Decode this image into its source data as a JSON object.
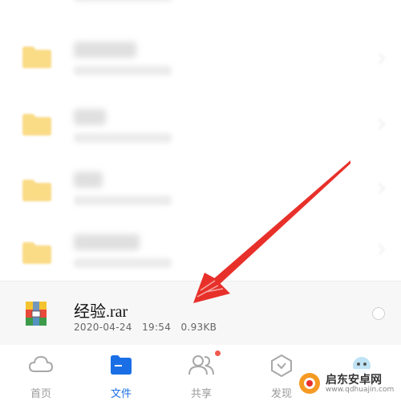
{
  "file_item": {
    "name": "经验.rar",
    "date": "2020-04-24",
    "time": "19:54",
    "size": "0.93KB"
  },
  "tabs": [
    {
      "label": "首页",
      "icon": "cloud-icon",
      "active": false
    },
    {
      "label": "文件",
      "icon": "folder-icon",
      "active": true
    },
    {
      "label": "共享",
      "icon": "people-icon",
      "active": false,
      "badge": true
    },
    {
      "label": "发现",
      "icon": "compass-icon",
      "active": false
    }
  ],
  "watermark": {
    "text": "启东安卓网",
    "url": "www.qdhuajin.com"
  },
  "colors": {
    "accent": "#1a6fe6",
    "folder": "#f7c948",
    "arrow": "#e8302a",
    "badge": "#f05a4f"
  }
}
